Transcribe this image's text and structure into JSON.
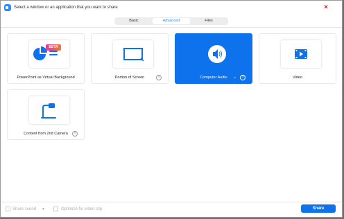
{
  "window": {
    "title": "Select a window or an application that you want to share",
    "close_glyph": "✕"
  },
  "tabs": [
    {
      "label": "Basic",
      "active": false
    },
    {
      "label": "Advanced",
      "active": true
    },
    {
      "label": "Files",
      "active": false
    }
  ],
  "cards": [
    {
      "label": "PowerPoint as Virtual Background",
      "icon": "powerpoint-icon",
      "badge": "BETA",
      "selected": false
    },
    {
      "label": "Portion of Screen",
      "icon": "screen-portion-icon",
      "help": "?",
      "selected": false
    },
    {
      "label": "Computer Audio",
      "icon": "speaker-icon",
      "help": "?",
      "caret": "⌄",
      "selected": true
    },
    {
      "label": "Video",
      "icon": "video-icon",
      "selected": false
    },
    {
      "label": "Content from 2nd Camera",
      "icon": "camera-icon",
      "help": "?",
      "selected": false
    }
  ],
  "footer": {
    "share_sound": "Share sound",
    "share_sound_caret": "▾",
    "optimize": "Optimize for video clip",
    "share_button": "Share"
  },
  "colors": {
    "accent": "#0e72ed",
    "tab_active_text": "#2d8cff",
    "close": "#c00000"
  }
}
